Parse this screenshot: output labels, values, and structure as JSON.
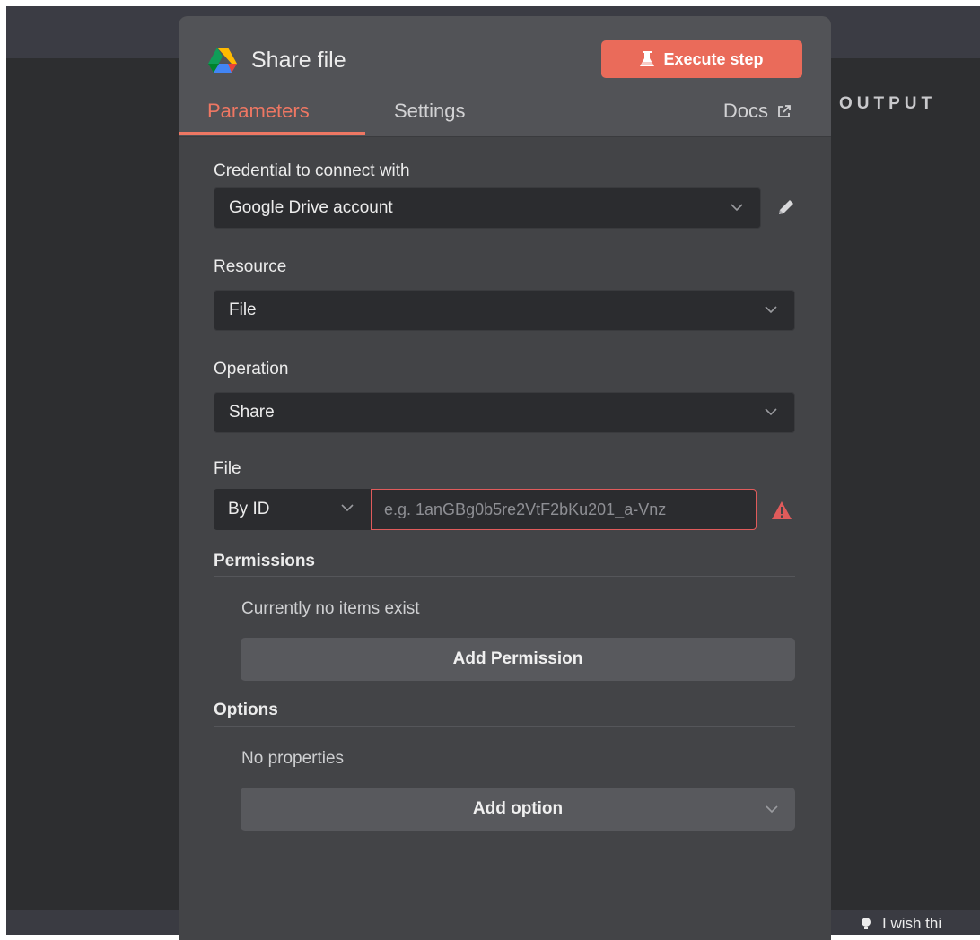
{
  "output": {
    "title": "OUTPUT"
  },
  "footer": {
    "feedback_text": "I wish thi"
  },
  "node": {
    "title": "Share file",
    "execute_label": "Execute step",
    "tabs": [
      {
        "label": "Parameters",
        "active": true
      },
      {
        "label": "Settings",
        "active": false
      }
    ],
    "docs_label": "Docs"
  },
  "params": {
    "credential": {
      "label": "Credential to connect with",
      "value": "Google Drive account"
    },
    "resource": {
      "label": "Resource",
      "value": "File"
    },
    "operation": {
      "label": "Operation",
      "value": "Share"
    },
    "file": {
      "label": "File",
      "mode": "By ID",
      "placeholder": "e.g. 1anGBg0b5re2VtF2bKu201_a-Vnz",
      "value": ""
    },
    "permissions": {
      "label": "Permissions",
      "empty_text": "Currently no items exist",
      "add_label": "Add Permission"
    },
    "options": {
      "label": "Options",
      "empty_text": "No properties",
      "add_label": "Add option"
    }
  },
  "colors": {
    "accent": "#ea6b5a",
    "active_tab": "#ee7763",
    "error": "#e05b5b",
    "panel": "#434447",
    "background": "#2d2e30"
  }
}
